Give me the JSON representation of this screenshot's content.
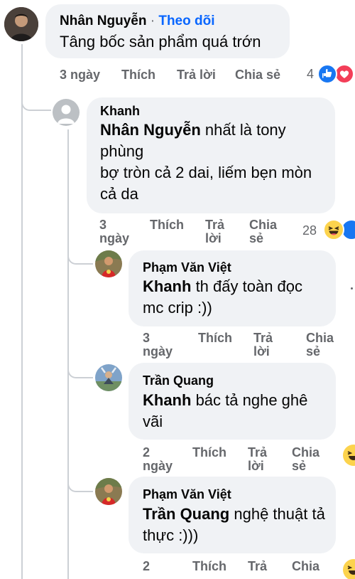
{
  "comments": [
    {
      "author": "Nhân Nguyễn",
      "follow_sep": " · ",
      "follow_label": "Theo dõi",
      "text": "Tâng bốc sản phẩm quá trớn",
      "time": "3 ngày",
      "like": "Thích",
      "reply": "Trả lời",
      "share": "Chia sẻ",
      "count": "4"
    },
    {
      "author": "Khanh",
      "mention": "Nhân Nguyễn",
      "text_rest": " nhất là tony phùng",
      "text_line2": "bợ tròn cả 2 dai, liếm bẹn mòn cả da",
      "time_top": "3",
      "time_bottom": "ngày",
      "like": "Thích",
      "reply_top": "Trả",
      "reply_bottom": "lời",
      "share_top": "Chia",
      "share_bottom": "sẻ",
      "count": "28"
    },
    {
      "author": "Phạm Văn Việt",
      "mention": "Khanh",
      "text_rest": " th đấy toàn đọc mc crip :))",
      "time_top": "3",
      "time_bottom": "ngày",
      "like": "Thích",
      "reply_top": "Trả",
      "reply_bottom": "lời",
      "share_top": "Chia",
      "share_bottom": "sẻ"
    },
    {
      "author": "Trần Quang",
      "mention": "Khanh",
      "text_rest": " bác tả nghe ghê vãi",
      "time_top": "2",
      "time_bottom": "ngày",
      "like": "Thích",
      "reply_top": "Trả",
      "reply_bottom": "lời",
      "share_top": "Chia",
      "share_bottom": "sẻ"
    },
    {
      "author": "Phạm Văn Việt",
      "mention": "Trần Quang",
      "text_rest": " nghệ thuật tả thực :)))",
      "time_top": "2",
      "like": "Thích",
      "reply_top": "Trả",
      "share_top": "Chia"
    }
  ],
  "colors": {
    "bubble": "#f0f2f5",
    "secondary_text": "#65676b",
    "link_blue": "#0866ff",
    "thread_line": "#ccd0d5"
  },
  "icons": [
    "like-reaction-icon",
    "love-reaction-icon",
    "haha-reaction-icon"
  ]
}
